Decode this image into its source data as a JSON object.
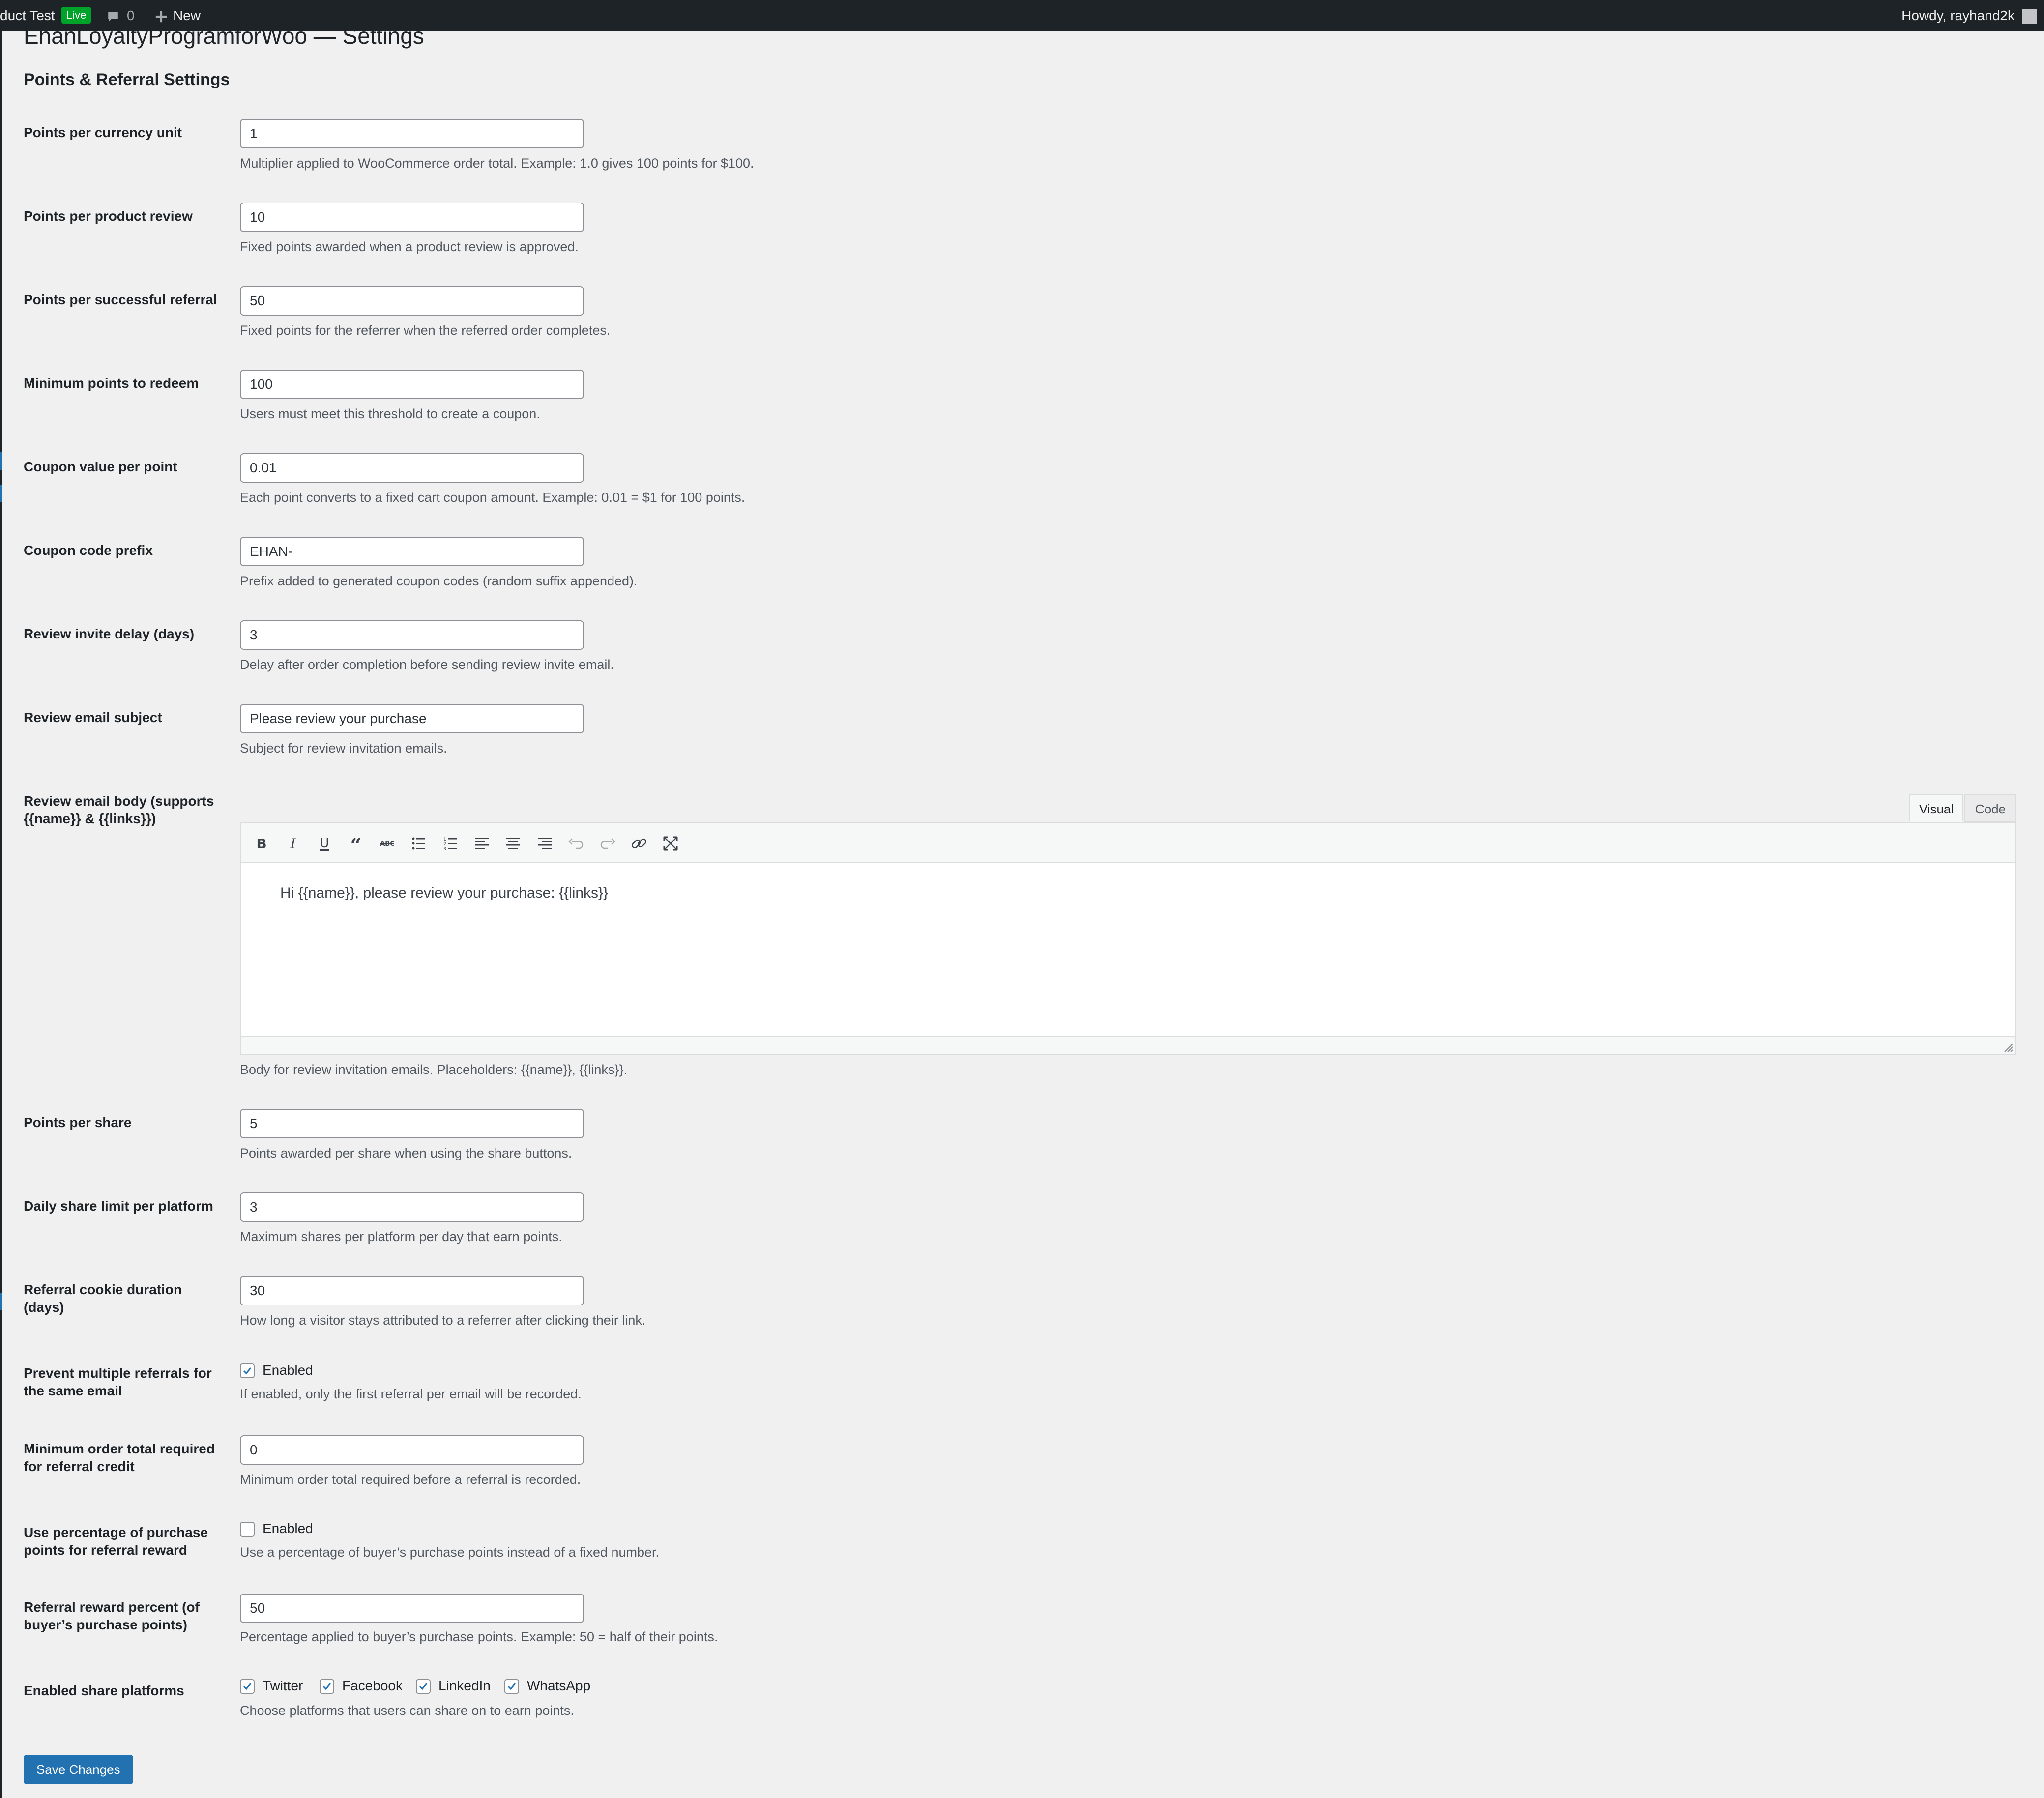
{
  "admin_bar": {
    "site_name": "duct Test",
    "live_badge": "Live",
    "comments_count": "0",
    "new_label": "New",
    "greeting": "Howdy, rayhand2k"
  },
  "page": {
    "title": "EhanLoyaltyProgramforWoo — Settings",
    "section_title": "Points & Referral Settings"
  },
  "fields": {
    "points_per_currency": {
      "label": "Points per currency unit",
      "value": "1",
      "description": "Multiplier applied to WooCommerce order total. Example: 1.0 gives 100 points for $100."
    },
    "points_per_review": {
      "label": "Points per product review",
      "value": "10",
      "description": "Fixed points awarded when a product review is approved."
    },
    "points_per_referral": {
      "label": "Points per successful referral",
      "value": "50",
      "description": "Fixed points for the referrer when the referred order completes."
    },
    "min_points_redeem": {
      "label": "Minimum points to redeem",
      "value": "100",
      "description": "Users must meet this threshold to create a coupon."
    },
    "coupon_value": {
      "label": "Coupon value per point",
      "value": "0.01",
      "description": "Each point converts to a fixed cart coupon amount. Example: 0.01 = $1 for 100 points."
    },
    "coupon_prefix": {
      "label": "Coupon code prefix",
      "value": "EHAN-",
      "description": "Prefix added to generated coupon codes (random suffix appended)."
    },
    "review_delay": {
      "label": "Review invite delay (days)",
      "value": "3",
      "description": "Delay after order completion before sending review invite email."
    },
    "review_subject": {
      "label": "Review email subject",
      "value": "Please review your purchase",
      "description": "Subject for review invitation emails."
    },
    "review_body": {
      "label_line1": "Review email body (supports",
      "label_line2": "{{name}} & {{links}})",
      "content": "Hi {{name}}, please review your purchase: {{links}}",
      "description": "Body for review invitation emails. Placeholders: {{name}}, {{links}}.",
      "tab_visual": "Visual",
      "tab_code": "Code"
    },
    "points_per_share": {
      "label": "Points per share",
      "value": "5",
      "description": "Points awarded per share when using the share buttons."
    },
    "daily_share_limit": {
      "label": "Daily share limit per platform",
      "value": "3",
      "description": "Maximum shares per platform per day that earn points."
    },
    "cookie_duration": {
      "label_line1": "Referral cookie duration",
      "label_line2": "(days)",
      "value": "30",
      "description": "How long a visitor stays attributed to a referrer after clicking their link."
    },
    "prevent_multiple": {
      "label_line1": "Prevent multiple referrals for",
      "label_line2": "the same email",
      "checked": true,
      "check_label": "Enabled",
      "description": "If enabled, only the first referral per email will be recorded."
    },
    "min_order_total": {
      "label_line1": "Minimum order total required",
      "label_line2": "for referral credit",
      "value": "0",
      "description": "Minimum order total required before a referral is recorded."
    },
    "use_percentage": {
      "label_line1": "Use percentage of purchase",
      "label_line2": "points for referral reward",
      "checked": false,
      "check_label": "Enabled",
      "description": "Use a percentage of buyer’s purchase points instead of a fixed number."
    },
    "referral_percent": {
      "label_line1": "Referral reward percent (of",
      "label_line2": "buyer’s purchase points)",
      "value": "50",
      "description": "Percentage applied to buyer’s purchase points. Example: 50 = half of their points."
    },
    "share_platforms": {
      "label": "Enabled share platforms",
      "platforms": [
        "Twitter",
        "Facebook",
        "LinkedIn",
        "WhatsApp"
      ],
      "description": "Choose platforms that users can share on to earn points."
    }
  },
  "save_button": "Save Changes"
}
